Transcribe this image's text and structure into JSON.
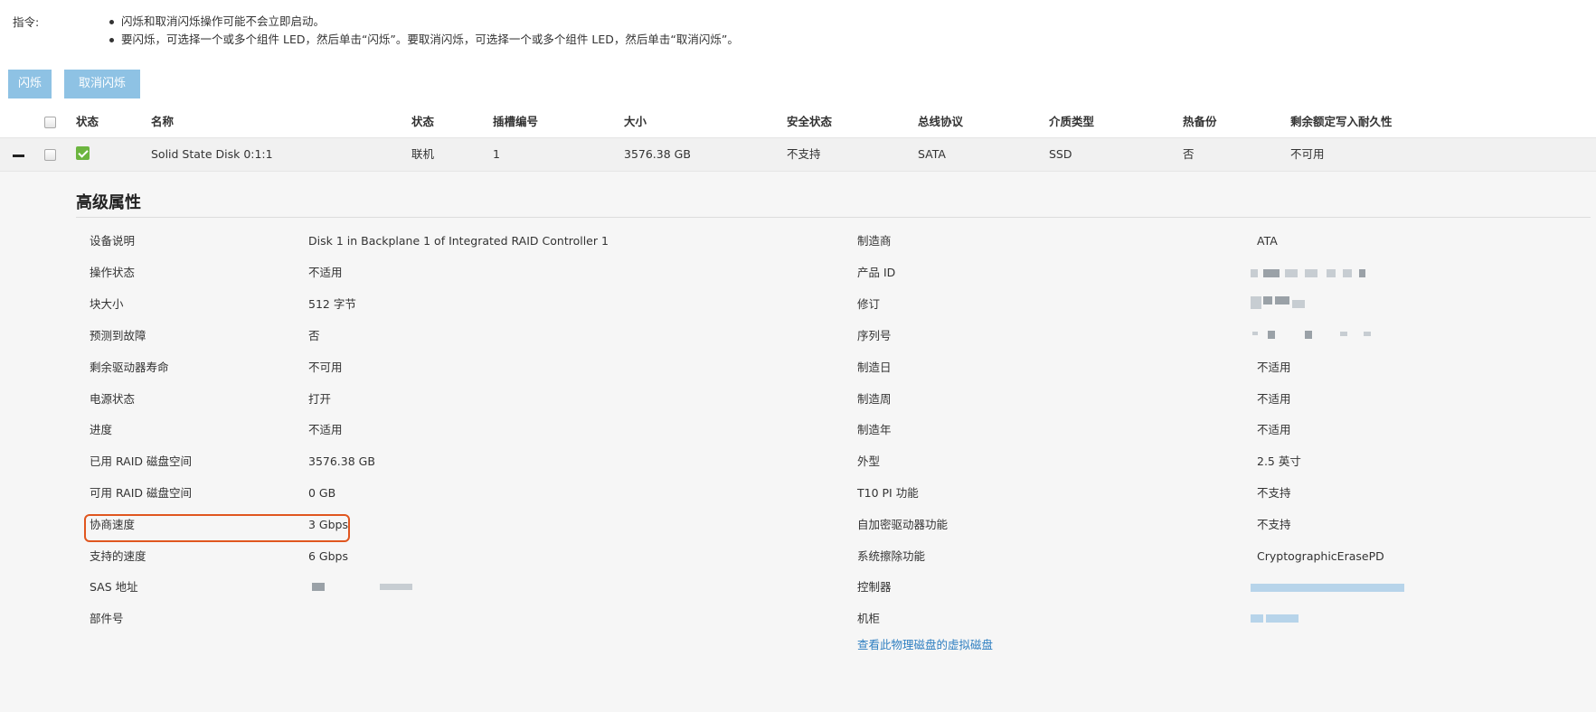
{
  "instructions": {
    "label": "指令:",
    "items": [
      "闪烁和取消闪烁操作可能不会立即启动。",
      "要闪烁，可选择一个或多个组件 LED，然后单击“闪烁”。要取消闪烁，可选择一个或多个组件 LED，然后单击“取消闪烁”。"
    ]
  },
  "buttons": {
    "blink": "闪烁",
    "unblink": "取消闪烁"
  },
  "table": {
    "headers": [
      "状态",
      "名称",
      "状态",
      "插槽编号",
      "大小",
      "安全状态",
      "总线协议",
      "介质类型",
      "热备份",
      "剩余额定写入耐久性"
    ],
    "row": {
      "status_icon": "check-icon",
      "name": "Solid State Disk 0:1:1",
      "state": "联机",
      "slot": "1",
      "size": "3576.38 GB",
      "security": "不支持",
      "bus": "SATA",
      "media": "SSD",
      "hotspare": "否",
      "endurance": "不可用"
    }
  },
  "advanced": {
    "title": "高级属性",
    "left": [
      {
        "label": "设备说明",
        "value": "Disk 1 in Backplane 1 of Integrated RAID Controller 1"
      },
      {
        "label": "操作状态",
        "value": "不适用"
      },
      {
        "label": "块大小",
        "value": "512 字节"
      },
      {
        "label": "预测到故障",
        "value": "否"
      },
      {
        "label": "剩余驱动器寿命",
        "value": "不可用"
      },
      {
        "label": "电源状态",
        "value": "打开"
      },
      {
        "label": "进度",
        "value": "不适用"
      },
      {
        "label": "已用 RAID 磁盘空间",
        "value": "3576.38 GB"
      },
      {
        "label": "可用 RAID 磁盘空间",
        "value": "0 GB"
      },
      {
        "label": "协商速度",
        "value": "3 Gbps"
      },
      {
        "label": "支持的速度",
        "value": "6 Gbps"
      },
      {
        "label": "SAS 地址",
        "value": ""
      },
      {
        "label": "部件号",
        "value": ""
      }
    ],
    "right": [
      {
        "label": "制造商",
        "value": "ATA"
      },
      {
        "label": "产品 ID",
        "value": ""
      },
      {
        "label": "修订",
        "value": ""
      },
      {
        "label": "序列号",
        "value": ""
      },
      {
        "label": "制造日",
        "value": "不适用"
      },
      {
        "label": "制造周",
        "value": "不适用"
      },
      {
        "label": "制造年",
        "value": "不适用"
      },
      {
        "label": "外型",
        "value": "2.5 英寸"
      },
      {
        "label": "T10 PI 功能",
        "value": "不支持"
      },
      {
        "label": "自加密驱动器功能",
        "value": "不支持"
      },
      {
        "label": "系统擦除功能",
        "value": "CryptographicErasePD"
      },
      {
        "label": "控制器",
        "value": ""
      },
      {
        "label": "机柜",
        "value": ""
      }
    ],
    "link": "查看此物理磁盘的虚拟磁盘"
  },
  "colors": {
    "button": "#8ec2e4",
    "link": "#2f7fc1",
    "highlight": "#e0561f",
    "ok": "#6cb53f"
  }
}
